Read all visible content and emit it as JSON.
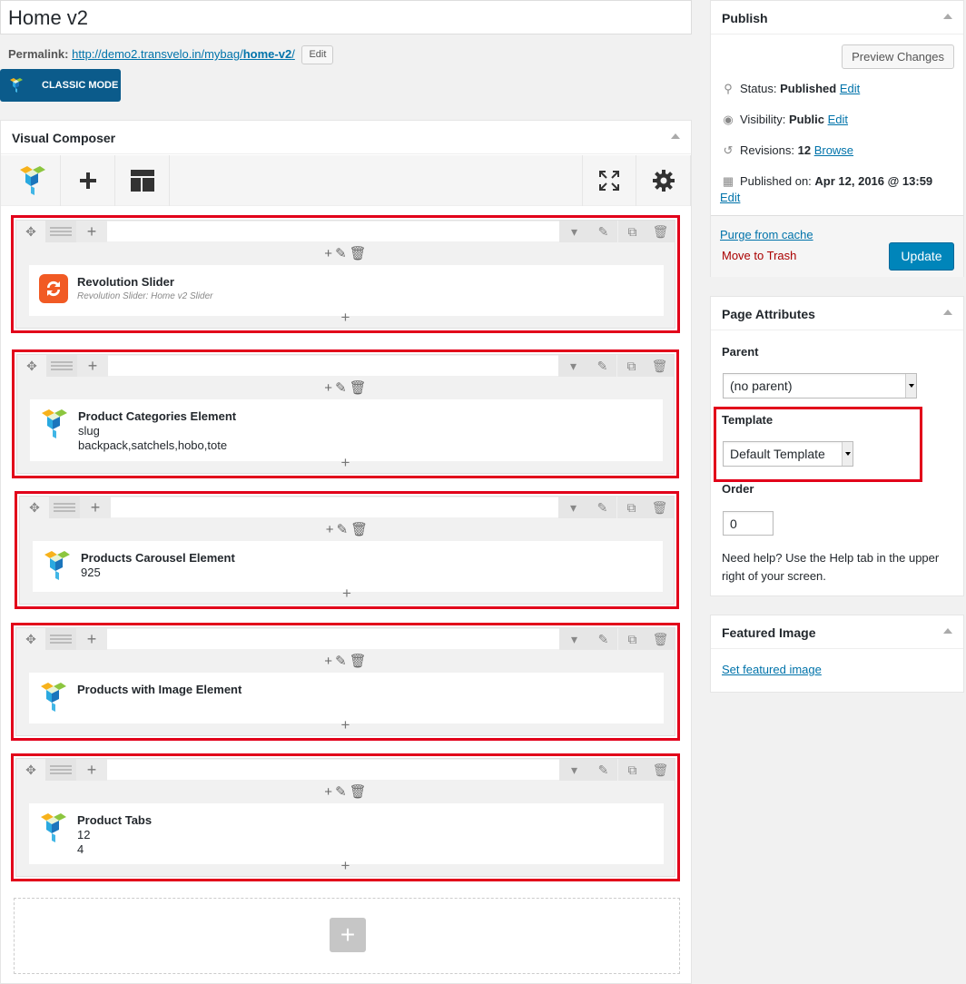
{
  "post": {
    "title": "Home v2",
    "permalink_label": "Permalink:",
    "permalink_base": "http://demo2.transvelo.in/mybag/",
    "permalink_slug": "home-v2",
    "permalink_trailing": "/",
    "permalink_edit": "Edit",
    "classic_mode": "CLASSIC MODE"
  },
  "visual_composer": {
    "title": "Visual Composer",
    "rows": [
      {
        "title": "Revolution Slider",
        "lines": [],
        "subtitle": "Revolution Slider: Home v2 Slider",
        "icon": "revolution-slider-icon"
      },
      {
        "title": "Product Categories Element",
        "lines": [
          "slug",
          "backpack,satchels,hobo,tote"
        ],
        "subtitle": "",
        "icon": "vc-element-icon"
      },
      {
        "title": "Products Carousel Element",
        "lines": [
          "925"
        ],
        "subtitle": "",
        "icon": "vc-element-icon"
      },
      {
        "title": "Products with Image Element",
        "lines": [],
        "subtitle": "",
        "icon": "vc-element-icon"
      },
      {
        "title": "Product Tabs",
        "lines": [
          "12",
          "4"
        ],
        "subtitle": "",
        "icon": "vc-element-icon"
      }
    ]
  },
  "publish": {
    "title": "Publish",
    "preview_button": "Preview Changes",
    "status_label": "Status:",
    "status_value": "Published",
    "status_edit": "Edit",
    "visibility_label": "Visibility:",
    "visibility_value": "Public",
    "visibility_edit": "Edit",
    "revisions_label": "Revisions:",
    "revisions_value": "12",
    "revisions_browse": "Browse",
    "published_label": "Published on:",
    "published_value": "Apr 12, 2016 @ 13:59",
    "published_edit": "Edit",
    "purge": "Purge from cache",
    "trash": "Move to Trash",
    "update": "Update"
  },
  "page_attributes": {
    "title": "Page Attributes",
    "parent_label": "Parent",
    "parent_value": "(no parent)",
    "template_label": "Template",
    "template_value": "Default Template",
    "order_label": "Order",
    "order_value": "0",
    "help_text": "Need help? Use the Help tab in the upper right of your screen."
  },
  "featured_image": {
    "title": "Featured Image",
    "link": "Set featured image"
  },
  "colors": {
    "highlight": "#e2001a",
    "primary": "#0085ba",
    "classic_mode_bg": "#0b5b8b"
  }
}
